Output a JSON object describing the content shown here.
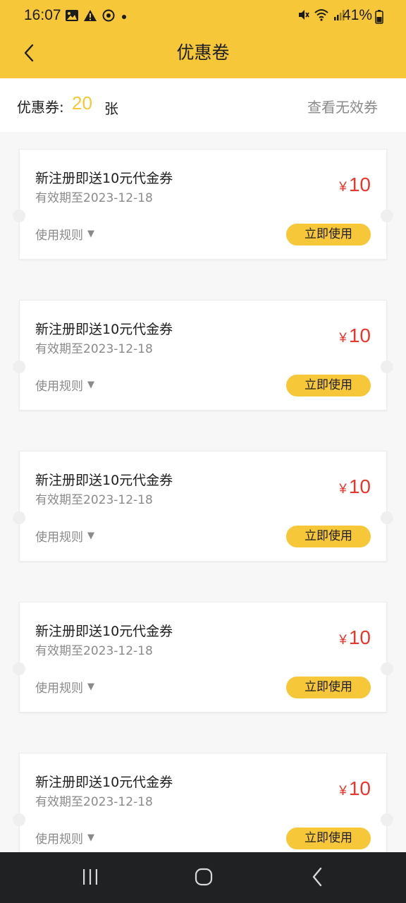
{
  "status_bar": {
    "time": "16:07",
    "battery": "41%",
    "left_icons": [
      "image-icon",
      "warning-icon",
      "sync-icon",
      "dot-icon"
    ],
    "right_icons": [
      "mute-icon",
      "wifi-icon",
      "signal-icon",
      "battery-icon"
    ]
  },
  "header": {
    "title": "优惠卷",
    "back_icon": "chevron-left-icon"
  },
  "summary": {
    "label": "优惠券:",
    "count": "20",
    "unit": "张",
    "invalid_link": "查看无效券"
  },
  "coupons": [
    {
      "title": "新注册即送10元代金券",
      "expiry": "有效期至2023-12-18",
      "currency": "¥",
      "amount": "10",
      "rules_label": "使用规则",
      "use_label": "立即使用"
    },
    {
      "title": "新注册即送10元代金券",
      "expiry": "有效期至2023-12-18",
      "currency": "¥",
      "amount": "10",
      "rules_label": "使用规则",
      "use_label": "立即使用"
    },
    {
      "title": "新注册即送10元代金券",
      "expiry": "有效期至2023-12-18",
      "currency": "¥",
      "amount": "10",
      "rules_label": "使用规则",
      "use_label": "立即使用"
    },
    {
      "title": "新注册即送10元代金券",
      "expiry": "有效期至2023-12-18",
      "currency": "¥",
      "amount": "10",
      "rules_label": "使用规则",
      "use_label": "立即使用"
    },
    {
      "title": "新注册即送10元代金券",
      "expiry": "有效期至2023-12-18",
      "currency": "¥",
      "amount": "10",
      "rules_label": "使用规则",
      "use_label": "立即使用"
    }
  ],
  "nav_bar": {
    "buttons": [
      "recent-apps-icon",
      "home-icon",
      "back-icon"
    ]
  },
  "colors": {
    "accent": "#f6c738",
    "price": "#e8372c",
    "muted_text": "#8a8a8a",
    "nav_background": "#202122"
  }
}
